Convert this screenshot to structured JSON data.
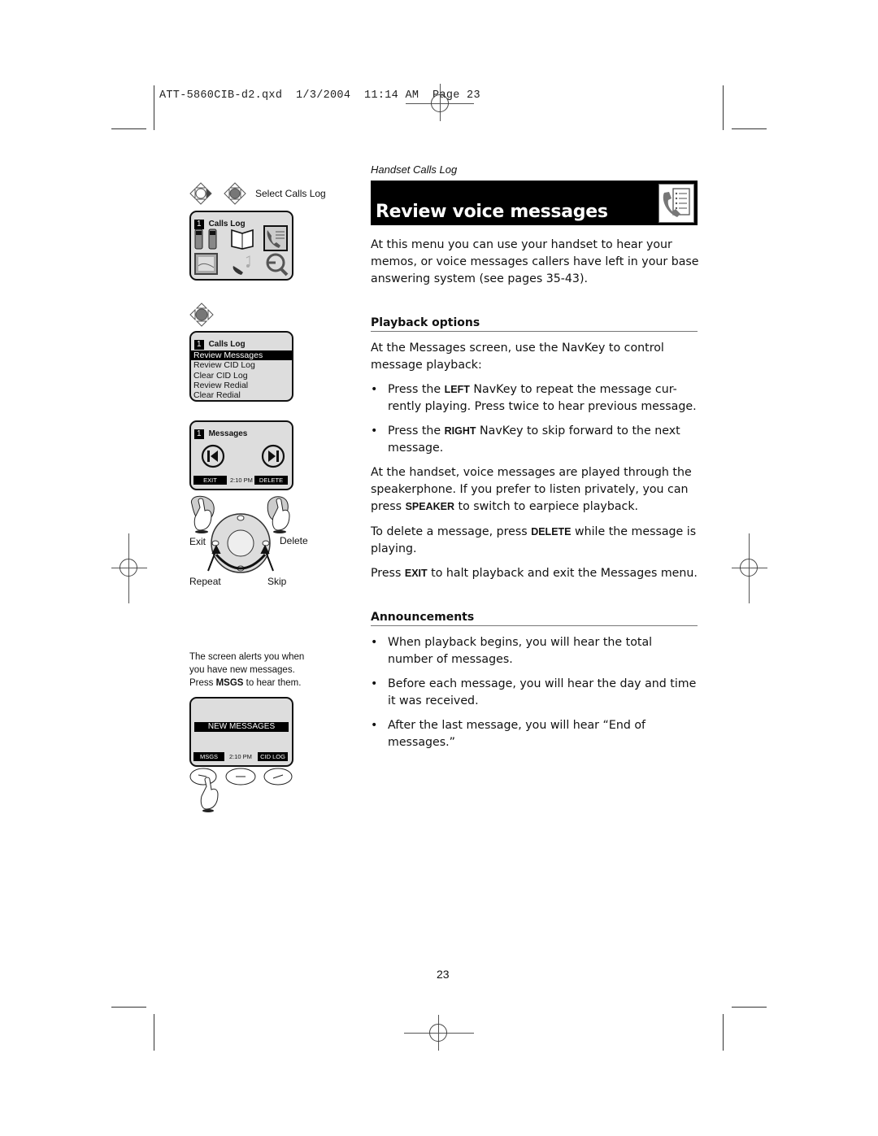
{
  "slug": "ATT-5860CIB-d2.qxd  1/3/2004  11:14 AM  Page 23",
  "section_kicker": "Handset Calls Log",
  "title": "Review voice messages",
  "title_icon": "calls-log-icon",
  "intro": "At this menu you can use your handset to hear your memos, or voice messages callers have left in your base answering system (see pages 35-43).",
  "playback": {
    "heading": "Playback options",
    "lead": "At the Messages screen, use the NavKey to control message playback:",
    "bullets": [
      {
        "pre": "Press the ",
        "key": "LEFT",
        "post": " NavKey to repeat the message cur-rently playing. Press twice to hear previous message."
      },
      {
        "pre": "Press the ",
        "key": "RIGHT",
        "post": " NavKey to skip forward to the next message."
      }
    ],
    "para1_pre": "At the handset, voice messages are played through the speakerphone. If you prefer to listen privately, you can press ",
    "para1_key": "SPEAKER",
    "para1_post": " to switch to earpiece playback.",
    "para2_pre": "To delete a message, press ",
    "para2_key": "DELETE",
    "para2_post": " while the message is playing.",
    "para3_pre": "Press ",
    "para3_key": "EXIT",
    "para3_post": " to halt playback and exit the Messages menu."
  },
  "announcements": {
    "heading": "Announcements",
    "bullets": [
      "When playback begins, you will hear the total number of messages.",
      "Before each message, you will hear the day and time it was received.",
      "After the last message, you will hear “End of messages.”"
    ]
  },
  "sidebar": {
    "step1_label": "Select Calls Log",
    "screen1": {
      "num": "1",
      "title": "Calls Log"
    },
    "screen2": {
      "num": "1",
      "title": "Calls Log",
      "items": [
        "Review Messages",
        "Review CID Log",
        "Clear CID Log",
        "Review Redial",
        "Clear Redial"
      ],
      "selected_index": 0
    },
    "screen3": {
      "num": "1",
      "title": "Messages",
      "left_soft": "EXIT",
      "time": "2:10 PM",
      "right_soft": "DELETE"
    },
    "navkey_labels": {
      "exit": "Exit",
      "delete": "Delete",
      "repeat": "Repeat",
      "skip": "Skip"
    },
    "alert_note_pre": "The screen alerts you when you have new messages. Press ",
    "alert_note_key": "MSGS",
    "alert_note_post": " to hear them.",
    "screen4": {
      "banner": "NEW MESSAGES",
      "left_soft": "MSGS",
      "time": "2:10 PM",
      "right_soft": "CID LOG"
    }
  },
  "page_number": "23"
}
